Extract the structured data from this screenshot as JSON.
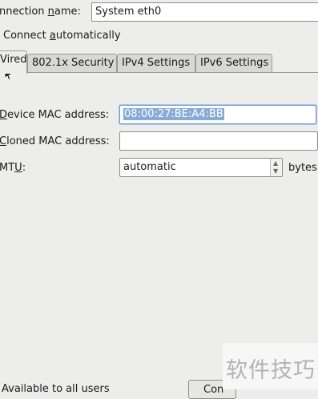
{
  "connection_name": {
    "label_pre": "nnection ",
    "label_u": "n",
    "label_post": "ame:",
    "value": "System eth0"
  },
  "connect_auto": {
    "pre": "Connect ",
    "u": "a",
    "post": "utomatically"
  },
  "tabs": [
    {
      "label": "Vired"
    },
    {
      "label": "802.1x Security"
    },
    {
      "label": "IPv4 Settings"
    },
    {
      "label": "IPv6 Settings"
    }
  ],
  "device_mac": {
    "label_u": "D",
    "label_post": "evice MAC address:",
    "value": "08:00:27:BE:A4:BB"
  },
  "cloned_mac": {
    "label_u": "C",
    "label_post": "loned MAC address:",
    "value": ""
  },
  "mtu": {
    "label_pre": "MT",
    "label_u": "U",
    "label_post": ":",
    "value": "automatic",
    "unit": "bytes"
  },
  "bottom": {
    "available_users": "Available to all users",
    "button_partial": "Con"
  },
  "watermark": "软件技巧",
  "colors": {
    "selection": "#86abd9",
    "background": "#ededec"
  }
}
